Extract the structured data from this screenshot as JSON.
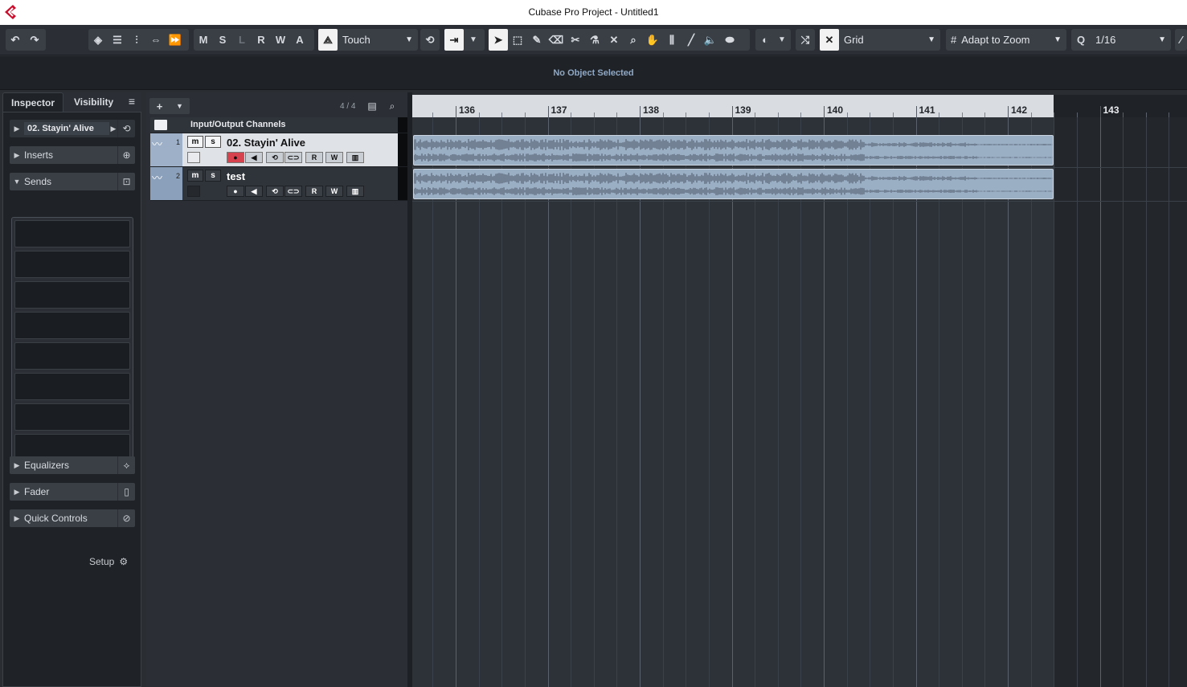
{
  "window": {
    "title": "Cubase Pro Project - Untitled1"
  },
  "toolbar": {
    "mode_buttons": [
      "M",
      "S",
      "L",
      "R",
      "W",
      "A"
    ],
    "automation_mode": "Touch",
    "snap_type": "Grid",
    "grid_type": "Adapt to Zoom",
    "quantize": "1/16"
  },
  "infoline": {
    "message": "No Object Selected"
  },
  "inspector": {
    "tabs": [
      "Inspector",
      "Visibility"
    ],
    "track_name": "02. Stayin' Alive",
    "sections": {
      "inserts": "Inserts",
      "sends": "Sends",
      "equalizers": "Equalizers",
      "fader": "Fader",
      "quick_controls": "Quick Controls"
    },
    "setup_label": "Setup"
  },
  "tracklist": {
    "track_count": "4 / 4",
    "folder_name": "Input/Output Channels",
    "tracks": [
      {
        "number": "1",
        "name": "02. Stayin' Alive",
        "selected": true
      },
      {
        "number": "2",
        "name": "test",
        "selected": false
      }
    ],
    "button_labels": {
      "mute": "m",
      "solo": "s",
      "read": "R",
      "write": "W"
    }
  },
  "ruler": {
    "bars": [
      "136",
      "137",
      "138",
      "139",
      "140",
      "141",
      "142",
      "143"
    ]
  }
}
